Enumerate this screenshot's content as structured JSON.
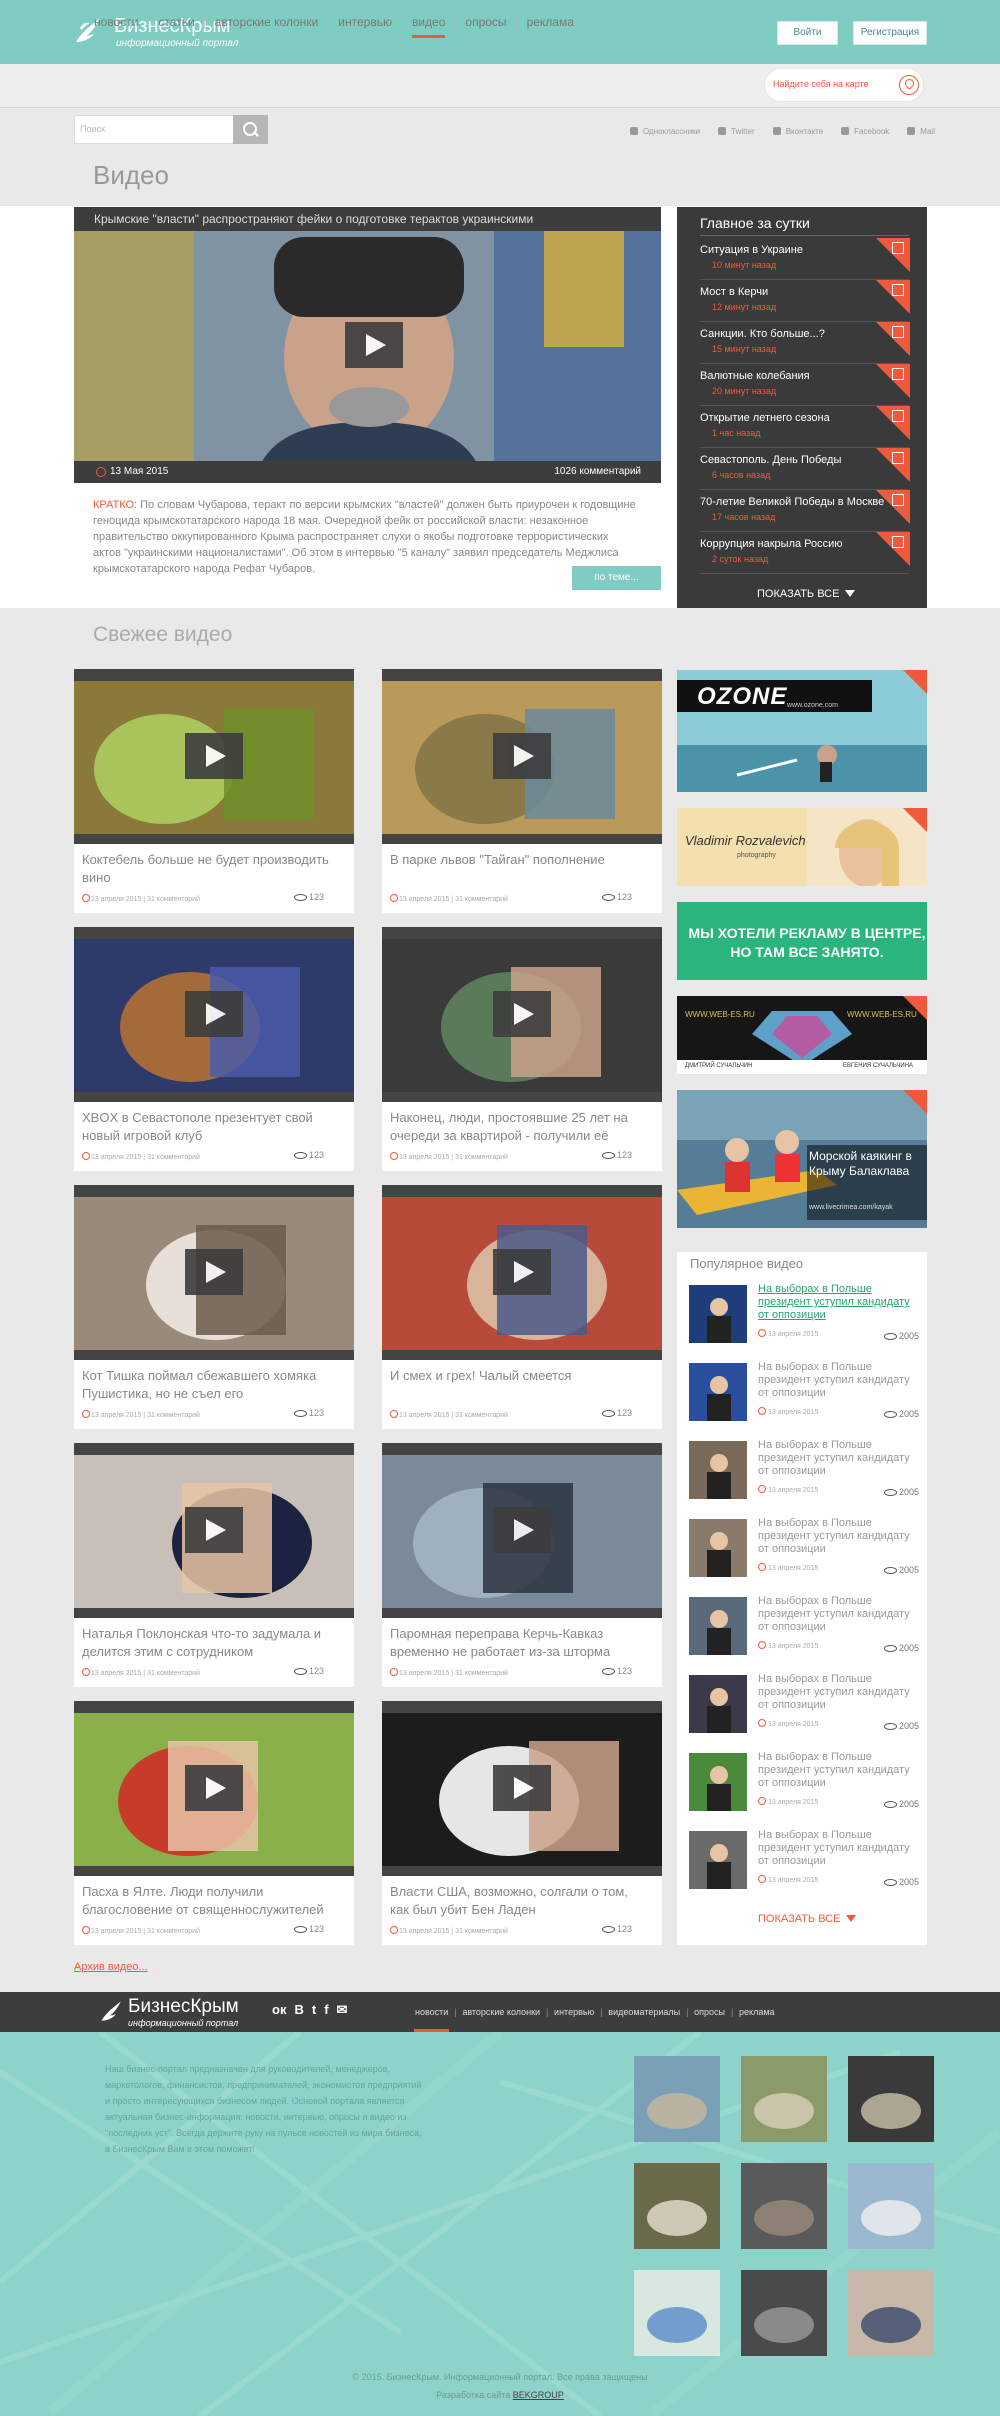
{
  "header": {
    "logo_title": "БизнесКрым",
    "logo_subtitle": "информационный портал",
    "login_label": "Войти",
    "register_label": "Регистрация"
  },
  "nav": {
    "items": [
      "новости",
      "статьи",
      "авторские колонки",
      "интервью",
      "видео",
      "опросы",
      "реклама"
    ],
    "active": "видео",
    "map_label": "Найдите себя на карте"
  },
  "search": {
    "placeholder": "Поиск"
  },
  "social": [
    "Одноклассники",
    "Twitter",
    "Вконтакте",
    "Facebook",
    "Mail"
  ],
  "page_title": "Видео",
  "main_video": {
    "title": "Крымские \"власти\" распространяют фейки о подготовке терактов украинскими",
    "date": "13 Мая 2015",
    "comments": "1026 комментарий",
    "lead_label": "КРАТКО:",
    "lead_text": "По словам Чубарова, теракт по версии крымских \"властей\" должен быть приурочен к годовщине геноцида крымскотатарского народа 18 мая. Очередной фейк от российской власти: незаконное правительство оккупированного Крыма распространяет слухи о якобы подготовке террористических актов \"украинскими националистами\". Об этом в интервью \"5 каналу\" заявил председатель Меджлиса крымскотатарского народа Рефат Чубаров.",
    "more_label": "по теме..."
  },
  "top_news": {
    "heading": "Главное за сутки",
    "items": [
      {
        "title": "Ситуация в Украине",
        "time": "10 минут назад"
      },
      {
        "title": "Мост в Керчи",
        "time": "12 минут назад"
      },
      {
        "title": "Санкции. Кто больше...?",
        "time": "15 минут назад"
      },
      {
        "title": "Валютные колебания",
        "time": "20 минут назад"
      },
      {
        "title": "Открытие летнего сезона",
        "time": "1 час назад"
      },
      {
        "title": "Севастополь. День Победы",
        "time": "6 часов назад"
      },
      {
        "title": "70-летие Великой Победы в Москве",
        "time": "17 часов назад"
      },
      {
        "title": "Коррупция накрыла Россию",
        "time": "2 суток назад"
      }
    ],
    "show_all": "ПОКАЗАТЬ ВСЕ"
  },
  "fresh": {
    "heading": "Свежее видео",
    "cards": [
      {
        "title": "Коктебель больше не будет производить вино",
        "meta": "13 апреля 2015 | 31 комментарий",
        "views": "123"
      },
      {
        "title": "В парке львов \"Тайган\" пополнение",
        "meta": "13 апреля 2015 | 31 комментарий",
        "views": "123"
      },
      {
        "title": "XBOX в Севастополе презентует свой новый игровой клуб",
        "meta": "13 апреля 2015 | 31 комментарий",
        "views": "123"
      },
      {
        "title": "Наконец, люди, простоявшие 25 лет на очереди за квартирой - получили её",
        "meta": "13 апреля 2015 | 31 комментарий",
        "views": "123"
      },
      {
        "title": "Кот Тишка поймал сбежавшего хомяка Пушистика, но не съел его",
        "meta": "13 апреля 2015 | 31 комментарий",
        "views": "123"
      },
      {
        "title": "И смех и грех! Чалый смеется",
        "meta": "13 апреля 2015 | 31 комментарий",
        "views": "123"
      },
      {
        "title": "Наталья Поклонская что-то задумала и делится этим с сотрудником",
        "meta": "13 апреля 2015 | 31 комментарий",
        "views": "123"
      },
      {
        "title": "Паромная переправа Керчь-Кавказ временно не работает из-за шторма",
        "meta": "13 апреля 2015 | 31 комментарий",
        "views": "123"
      },
      {
        "title": "Пасха в Ялте. Люди получили благословение от священнослужителей",
        "meta": "13 апреля 2015 | 31 комментарий",
        "views": "123"
      },
      {
        "title": "Власти США, возможно, солгали о том, как был убит Бен Ладен",
        "meta": "13 апреля 2015 | 31 комментарий",
        "views": "123"
      }
    ]
  },
  "ads": {
    "ozone": "OZONE",
    "ozone_url": "www.ozone.com",
    "photographer": "Vladimir Rozvalevich",
    "photographer_sub": "photography",
    "promo": "МЫ ХОТЕЛИ РЕКЛАМУ В ЦЕНТРЕ, НО ТАМ ВСЕ ЗАНЯТО.",
    "webes_left": "WWW.WEB-ES.RU",
    "webes_right": "WWW.WEB-ES.RU",
    "webes_name1": "ДМИТРИЙ СУЧАЛЬЧИН",
    "webes_name2": "ЕВГЕНИЯ СУЧАЛЬЧИНА",
    "kayak_title": "Морской каякинг в Крыму Балаклава",
    "kayak_url": "www.livecrimea.com/kayak"
  },
  "popular": {
    "heading": "Популярное видео",
    "items": [
      {
        "title": "На выборах в Польше президент уступил кандидату от оппозиции",
        "date": "13 апреля 2015",
        "views": "2005",
        "highlight": true
      },
      {
        "title": "На выборах в Польше президент уступил кандидату от оппозиции",
        "date": "13 апреля 2015",
        "views": "2005",
        "highlight": false
      },
      {
        "title": "На выборах в Польше президент уступил кандидату от оппозиции",
        "date": "13 апреля 2015",
        "views": "2005",
        "highlight": false
      },
      {
        "title": "На выборах в Польше президент уступил кандидату от оппозиции",
        "date": "13 апреля 2015",
        "views": "2005",
        "highlight": false
      },
      {
        "title": "На выборах в Польше президент уступил кандидату от оппозиции",
        "date": "13 апреля 2015",
        "views": "2005",
        "highlight": false
      },
      {
        "title": "На выборах в Польше президент уступил кандидату от оппозиции",
        "date": "13 апреля 2015",
        "views": "2005",
        "highlight": false
      },
      {
        "title": "На выборах в Польше президент уступил кандидату от оппозиции",
        "date": "13 апреля 2015",
        "views": "2005",
        "highlight": false
      },
      {
        "title": "На выборах в Польше президент уступил кандидату от оппозиции",
        "date": "13 апреля 2015",
        "views": "2005",
        "highlight": false
      }
    ],
    "show_all": "ПОКАЗАТЬ ВСЕ"
  },
  "archive_link": "Архив видео...",
  "footer": {
    "logo_title": "БизнесКрым",
    "logo_subtitle": "информационный портал",
    "social_glyphs": [
      "ок",
      "В",
      "t",
      "f",
      "✉"
    ],
    "nav": [
      "новости",
      "авторские колонки",
      "интервью",
      "видеоматериалы",
      "опросы",
      "реклама"
    ],
    "nav_active": "новости",
    "about": "Наш бизнес-портал предназначен для руководителей, менеджеров, маркетологов, финансистов, предпринимателей, экономистов предприятий и просто интересующихся бизнесом людей. Основой портала является актуальная бизнес-информация: новости, интервью, опросы и видео из \"последних уст\". Всегда держите руку на пульсе новостей из мира бизнеса, а БизнесКрым Вам в этом поможет!",
    "copyright": "© 2015. БизнесКрым. Информационный портал. Все права защищены",
    "dev_prefix": "Разработка сайта",
    "dev_link": "BEKGROUP"
  },
  "colors": {
    "accent": "#ef5a3c",
    "brand": "#7fcdc2",
    "dark": "#3a3a3a"
  }
}
